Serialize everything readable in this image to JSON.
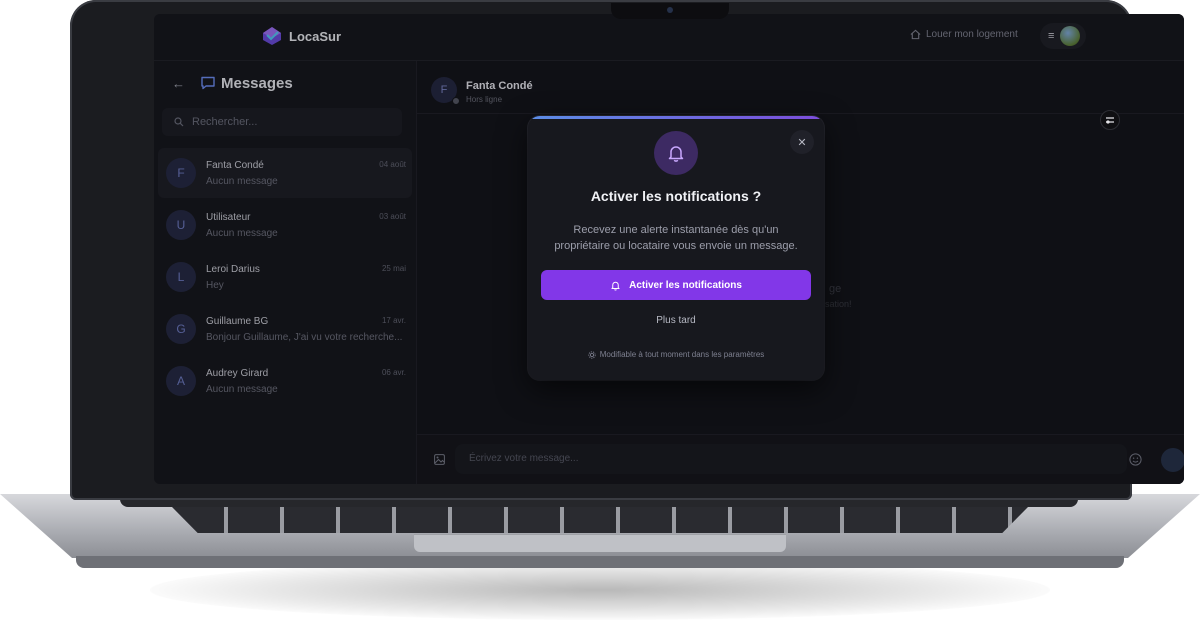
{
  "app": {
    "brand": "LocaSur",
    "rent_link": "Louer mon logement",
    "menu_icon": "hamburger-icon"
  },
  "sidebar": {
    "title": "Messages",
    "search_placeholder": "Rechercher...",
    "conversations": [
      {
        "initial": "F",
        "name": "Fanta Condé",
        "preview": "Aucun message",
        "date": "04 août",
        "active": true
      },
      {
        "initial": "U",
        "name": "Utilisateur",
        "preview": "Aucun message",
        "date": "03 août",
        "active": false
      },
      {
        "initial": "L",
        "name": "Leroi Darius",
        "preview": "Hey",
        "date": "25 mai",
        "active": false
      },
      {
        "initial": "G",
        "name": "Guillaume BG",
        "preview": "Bonjour Guillaume, J'ai vu votre recherche...",
        "date": "17 avr.",
        "active": false
      },
      {
        "initial": "A",
        "name": "Audrey Girard",
        "preview": "Aucun message",
        "date": "06 avr.",
        "active": false
      }
    ]
  },
  "chat": {
    "initial": "F",
    "name": "Fanta Condé",
    "status": "Hors ligne",
    "empty_title_fragment": "ge",
    "empty_sub_fragment": "ersation!",
    "composer_placeholder": "Écrivez votre message..."
  },
  "modal": {
    "title": "Activer les notifications ?",
    "description": "Recevez une alerte instantanée dès qu'un propriétaire ou locataire vous envoie un message.",
    "primary_label": "Activer les notifications",
    "secondary_label": "Plus tard",
    "footer": "Modifiable à tout moment dans les paramètres",
    "accent_color": "#8237e8"
  }
}
